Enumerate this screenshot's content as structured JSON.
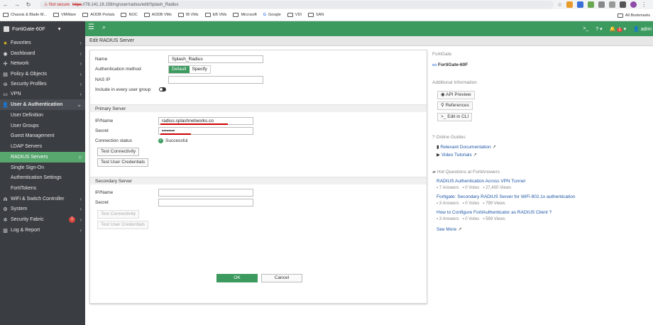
{
  "browser": {
    "not_secure": "Not secure",
    "url_scheme": "https",
    "url_rest": "://78.141.18.158/ng/user/radius/edit/Splash_Radius",
    "bookmarks": [
      "Chassis & Blade M...",
      "VMWare",
      "AODB Portals",
      "NOC",
      "AODB VMs",
      "IB VMs",
      "EB VMs",
      "Microsoft",
      "Google",
      "VDI",
      "SAN"
    ],
    "all_bookmarks": "All Bookmarks"
  },
  "header": {
    "device": "FortiGate-60F",
    "notification_count": "1",
    "user": "admi"
  },
  "sidebar": {
    "items": [
      {
        "label": "Favorites",
        "icon": "star-icon"
      },
      {
        "label": "Dashboard",
        "icon": "dashboard-icon"
      },
      {
        "label": "Network",
        "icon": "network-icon"
      },
      {
        "label": "Policy & Objects",
        "icon": "policy-icon"
      },
      {
        "label": "Security Profiles",
        "icon": "security-profiles-icon"
      },
      {
        "label": "VPN",
        "icon": "vpn-icon"
      },
      {
        "label": "User & Authentication",
        "icon": "user-icon"
      },
      {
        "label": "User Definition"
      },
      {
        "label": "User Groups"
      },
      {
        "label": "Guest Management"
      },
      {
        "label": "LDAP Servers"
      },
      {
        "label": "RADIUS Servers"
      },
      {
        "label": "Single Sign-On"
      },
      {
        "label": "Authentication Settings"
      },
      {
        "label": "FortiTokens"
      },
      {
        "label": "WiFi & Switch Controller",
        "icon": "wifi-icon"
      },
      {
        "label": "System",
        "icon": "gear-icon"
      },
      {
        "label": "Security Fabric",
        "icon": "fabric-icon",
        "badge": "1"
      },
      {
        "label": "Log & Report",
        "icon": "report-icon"
      }
    ]
  },
  "page": {
    "title": "Edit RADIUS Server",
    "name_label": "Name",
    "name_value": "Splash_Radius",
    "auth_method_label": "Authentication method",
    "auth_default": "Default",
    "auth_specify": "Specify",
    "nas_ip_label": "NAS IP",
    "nas_ip_value": "",
    "include_group_label": "Include in every user group",
    "primary_header": "Primary Server",
    "ip_name_label": "IP/Name",
    "primary_ip_value": "radius.splashnetworks.co",
    "secret_label": "Secret",
    "primary_secret_value": "••••••••",
    "conn_status_label": "Connection status",
    "conn_status_value": "Successful",
    "test_connectivity": "Test Connectivity",
    "test_credentials": "Test User Credentials",
    "secondary_header": "Secondary Server",
    "secondary_ip_value": "",
    "secondary_secret_value": "",
    "ok": "OK",
    "cancel": "Cancel"
  },
  "right_panel": {
    "device_title": "FortiGate",
    "device_name": "FortiGate-60F",
    "additional_title": "Additional Information",
    "api_preview": "API Preview",
    "references": "References",
    "edit_cli": "Edit in CLI",
    "online_guides": "Online Guides",
    "relevant_doc": "Relevant Documentation",
    "video_tutorials": "Video Tutorials",
    "hot_questions": "Hot Questions at FortiAnswers",
    "questions": [
      {
        "title": "RADIUS Authentication Across VPN Tunnel",
        "answers": "7 Answers",
        "votes": "0 Votes",
        "views": "27,400 Views"
      },
      {
        "title": "Fortigate: Secondary RADIUS Server for WiFi 802.1x authentication",
        "answers": "3 Answers",
        "votes": "0 Votes",
        "views": "799 Views"
      },
      {
        "title": "How to Configure FortiAuthenticator as RADIUS Client ?",
        "answers": "3 Answers",
        "votes": "0 Votes",
        "views": "599 Views"
      }
    ],
    "see_more": "See More"
  }
}
